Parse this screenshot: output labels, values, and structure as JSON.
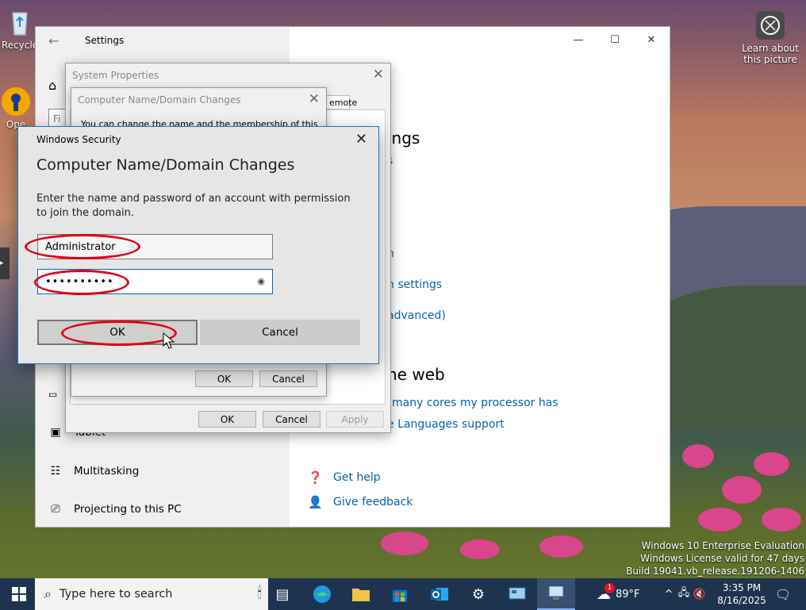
{
  "desktop": {
    "recycle_label": "Recycle",
    "open_label": "Ope",
    "learn_label_1": "Learn about",
    "learn_label_2": "this picture",
    "watermark": [
      "Windows 10 Enterprise Evaluation",
      "Windows License valid for 47 days",
      "Build 19041.vb_release.191206-1406"
    ]
  },
  "settings": {
    "title": "Settings",
    "search_placeholder": "Fi",
    "nav": [
      {
        "label": "Tablet",
        "icon": "tablet-icon"
      },
      {
        "label": "Multitasking",
        "icon": "multitasking-icon"
      },
      {
        "label": "Projecting to this PC",
        "icon": "projecting-icon"
      }
    ],
    "right": {
      "heading_1": "ings",
      "link_1": "s",
      "link_2": "n",
      "link_3": "n settings",
      "link_4": "advanced)",
      "heading_2": "he web",
      "link_5": "many cores my processor has",
      "link_6": "e Languages support",
      "get_help": "Get help",
      "give_feedback": "Give feedback"
    }
  },
  "system_properties": {
    "title": "System Properties",
    "tab_remote": "emote",
    "ok": "OK",
    "cancel": "Cancel",
    "apply": "Apply"
  },
  "computer_name_dialog": {
    "title": "Computer Name/Domain Changes",
    "body_partial": "You can change the name and the membership of this",
    "ok": "OK",
    "cancel": "Cancel"
  },
  "windows_security": {
    "title": "Windows Security",
    "heading": "Computer Name/Domain Changes",
    "message": "Enter the name and password of an account with permission to join the domain.",
    "username_value": "Administrator",
    "password_value": "••••••••••",
    "ok": "OK",
    "cancel": "Cancel"
  },
  "taskbar": {
    "search_placeholder": "Type here to search",
    "weather_temp": "89°F",
    "weather_badge": "1",
    "time": "3:35 PM",
    "date": "8/16/2025"
  }
}
